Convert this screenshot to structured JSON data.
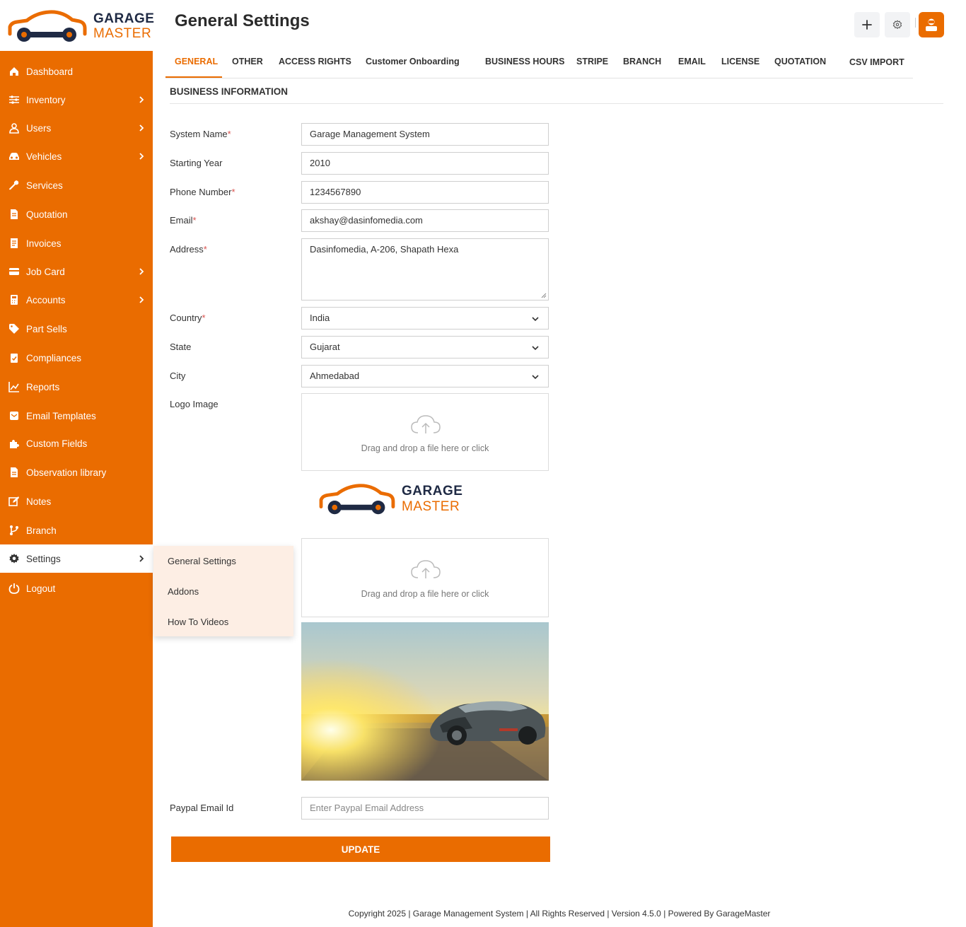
{
  "brand": {
    "line1": "GARAGE",
    "line2": "MASTER"
  },
  "sidebar": {
    "items": [
      {
        "label": "Dashboard",
        "icon": "home-icon",
        "has_submenu": false
      },
      {
        "label": "Inventory",
        "icon": "sliders-icon",
        "has_submenu": true
      },
      {
        "label": "Users",
        "icon": "user-icon",
        "has_submenu": true
      },
      {
        "label": "Vehicles",
        "icon": "car-icon",
        "has_submenu": true
      },
      {
        "label": "Services",
        "icon": "wrench-icon",
        "has_submenu": false
      },
      {
        "label": "Quotation",
        "icon": "document-icon",
        "has_submenu": false
      },
      {
        "label": "Invoices",
        "icon": "receipt-icon",
        "has_submenu": false
      },
      {
        "label": "Job Card",
        "icon": "card-icon",
        "has_submenu": true
      },
      {
        "label": "Accounts",
        "icon": "calculator-icon",
        "has_submenu": true
      },
      {
        "label": "Part Sells",
        "icon": "tag-icon",
        "has_submenu": false
      },
      {
        "label": "Compliances",
        "icon": "clipboard-check-icon",
        "has_submenu": false
      },
      {
        "label": "Reports",
        "icon": "chart-line-icon",
        "has_submenu": false
      },
      {
        "label": "Email Templates",
        "icon": "mail-box-icon",
        "has_submenu": false
      },
      {
        "label": "Custom Fields",
        "icon": "puzzle-icon",
        "has_submenu": false
      },
      {
        "label": "Observation library",
        "icon": "file-icon",
        "has_submenu": false
      },
      {
        "label": "Notes",
        "icon": "edit-icon",
        "has_submenu": false
      },
      {
        "label": "Branch",
        "icon": "branch-icon",
        "has_submenu": false
      },
      {
        "label": "Settings",
        "icon": "gear-icon",
        "has_submenu": true
      },
      {
        "label": "Logout",
        "icon": "power-icon",
        "has_submenu": false
      }
    ],
    "active": "Settings",
    "submenu": [
      "General Settings",
      "Addons",
      "How To Videos"
    ]
  },
  "header": {
    "title": "General Settings"
  },
  "tabs": [
    "GENERAL",
    "OTHER",
    "ACCESS RIGHTS",
    "Customer Onboarding",
    "BUSINESS HOURS",
    "STRIPE",
    "BRANCH",
    "EMAIL",
    "LICENSE",
    "QUOTATION",
    "CSV IMPORT"
  ],
  "active_tab": "GENERAL",
  "section_title": "BUSINESS INFORMATION",
  "form": {
    "system_name": {
      "label": "System Name",
      "required": true,
      "value": "Garage Management System"
    },
    "starting_year": {
      "label": "Starting Year",
      "required": false,
      "value": "2010"
    },
    "phone": {
      "label": "Phone Number",
      "required": true,
      "value": "1234567890"
    },
    "email": {
      "label": "Email",
      "required": true,
      "value": "akshay@dasinfomedia.com"
    },
    "address": {
      "label": "Address",
      "required": true,
      "value": "Dasinfomedia, A-206, Shapath Hexa"
    },
    "country": {
      "label": "Country",
      "required": true,
      "value": "India"
    },
    "state": {
      "label": "State",
      "required": false,
      "value": "Gujarat"
    },
    "city": {
      "label": "City",
      "required": false,
      "value": "Ahmedabad"
    },
    "logo_image": {
      "label": "Logo Image",
      "dropzone_text": "Drag and drop a file here or click"
    },
    "cover_image": {
      "dropzone_text": "Drag and drop a file here or click"
    },
    "paypal": {
      "label": "Paypal Email Id",
      "placeholder": "Enter Paypal Email Address"
    },
    "update_label": "UPDATE"
  },
  "required_mark": "*",
  "footer": "Copyright 2025 | Garage Management System | All Rights Reserved | Version 4.5.0 | Powered By GarageMaster",
  "colors": {
    "accent": "#ea6c00",
    "sidebar_bg": "#ea6c00",
    "submenu_bg": "#fdeee4",
    "navy": "#1f2a44"
  }
}
